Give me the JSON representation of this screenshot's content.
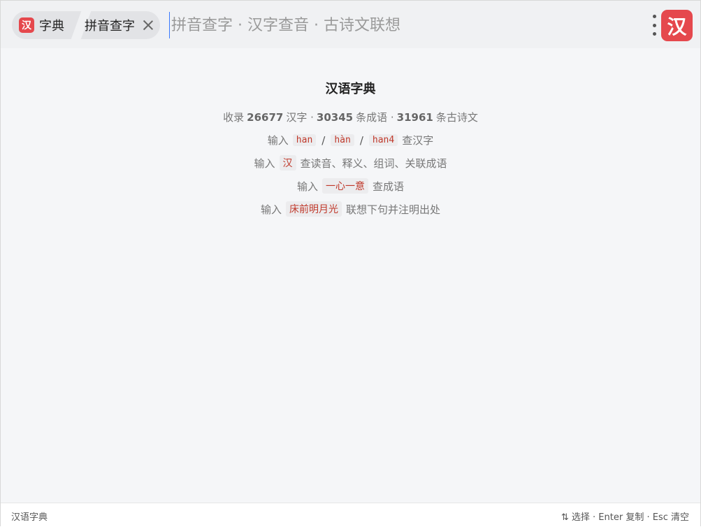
{
  "header": {
    "badge_glyph": "汉",
    "tab_dict_label": "字典",
    "tab_mode_label": "拼音查字",
    "search": {
      "value": "",
      "placeholder": "拼音查字 · 汉字查音 · 古诗文联想"
    },
    "more_icon": "more-vertical-icon",
    "logo_glyph": "汉"
  },
  "main": {
    "title": "汉语字典",
    "stats": {
      "prefix": "收录",
      "hanzi_count": "26677",
      "hanzi_label": "汉字 ·",
      "idiom_count": "30345",
      "idiom_label": "条成语 ·",
      "poem_count": "31961",
      "poem_label": "条古诗文"
    },
    "hints": [
      {
        "prefix": "输入",
        "examples": [
          "han",
          "hàn",
          "han4"
        ],
        "separator": "/",
        "suffix": "查汉字"
      },
      {
        "prefix": "输入",
        "examples": [
          "汉"
        ],
        "suffix": "查读音、释义、组词、关联成语"
      },
      {
        "prefix": "输入",
        "examples": [
          "一心一意"
        ],
        "suffix": "查成语"
      },
      {
        "prefix": "输入",
        "examples": [
          "床前明月光"
        ],
        "suffix": "联想下句并注明出处"
      }
    ]
  },
  "footer": {
    "left": "汉语字典",
    "right": "⇅ 选择 · Enter 复制 · Esc 清空"
  },
  "colors": {
    "accent": "#e5484d",
    "tag_text": "#c0392b",
    "caret": "#3a7afe"
  }
}
